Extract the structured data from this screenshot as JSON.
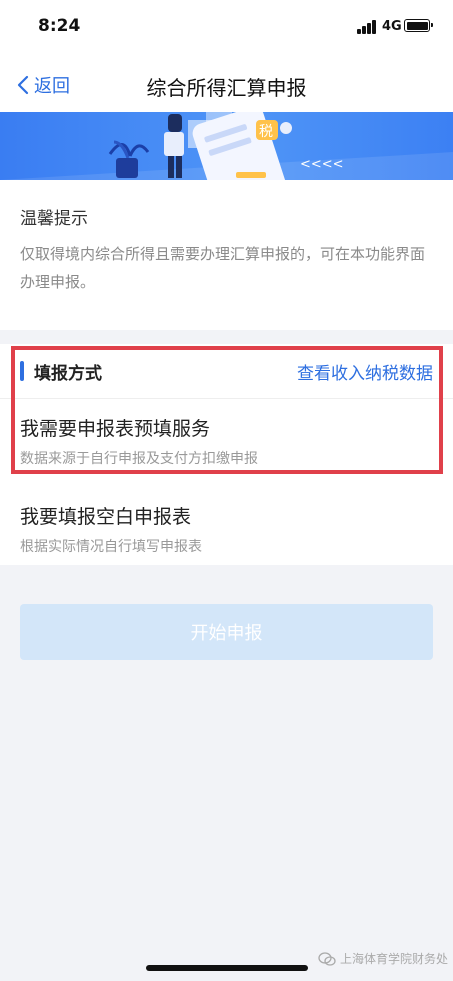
{
  "status_bar": {
    "time": "8:24",
    "network": "4G"
  },
  "nav": {
    "back_label": "返回",
    "title": "综合所得汇算申报"
  },
  "banner": {
    "tax_badge": "税",
    "arrows": "<<<<"
  },
  "tips": {
    "title": "温馨提示",
    "text": "仅取得境内综合所得且需要办理汇算申报的，可在本功能界面办理申报。"
  },
  "method": {
    "label": "填报方式",
    "link": "查看收入纳税数据",
    "options": [
      {
        "title": "我需要申报表预填服务",
        "subtitle": "数据来源于自行申报及支付方扣缴申报"
      },
      {
        "title": "我要填报空白申报表",
        "subtitle": "根据实际情况自行填写申报表"
      }
    ]
  },
  "actions": {
    "start_label": "开始申报"
  },
  "watermark": {
    "text": "上海体育学院财务处"
  },
  "colors": {
    "accent": "#2e6fe0",
    "highlight": "#e0404a",
    "button_disabled": "#d3e6f9"
  }
}
